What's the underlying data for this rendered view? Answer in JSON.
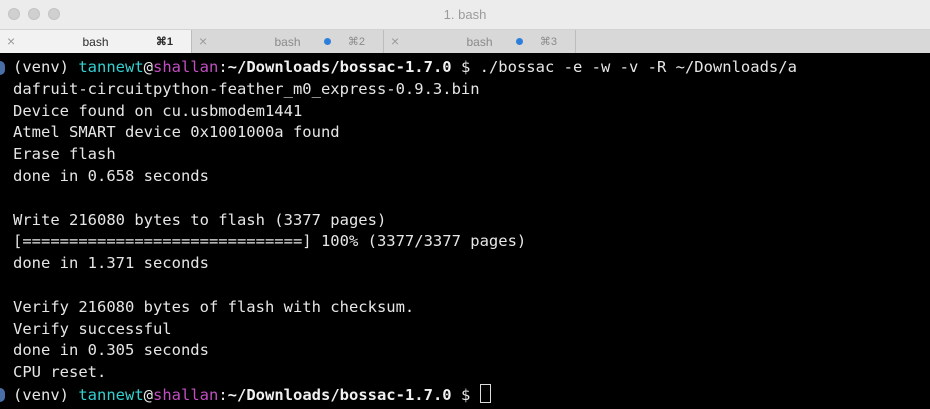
{
  "window": {
    "title": "1. bash"
  },
  "tabs": [
    {
      "close": "×",
      "label": "bash",
      "shortcut": "⌘1",
      "active": true,
      "dot": false
    },
    {
      "close": "×",
      "label": "bash",
      "shortcut": "⌘2",
      "active": false,
      "dot": true
    },
    {
      "close": "×",
      "label": "bash",
      "shortcut": "⌘3",
      "active": false,
      "dot": true
    }
  ],
  "prompt": {
    "prefix": "(venv) ",
    "user": "tannewt",
    "at": "@",
    "host": "shallan",
    "colon": ":",
    "path": "~/Downloads/bossac-1.7.0",
    "symbol": " $ "
  },
  "terminal": {
    "command": "./bossac -e -w -v -R ~/Downloads/a",
    "output": [
      "dafruit-circuitpython-feather_m0_express-0.9.3.bin",
      "Device found on cu.usbmodem1441",
      "Atmel SMART device 0x1001000a found",
      "Erase flash",
      "done in 0.658 seconds",
      "",
      "Write 216080 bytes to flash (3377 pages)",
      "[==============================] 100% (3377/3377 pages)",
      "done in 1.371 seconds",
      "",
      "Verify 216080 bytes of flash with checksum.",
      "Verify successful",
      "done in 0.305 seconds",
      "CPU reset."
    ]
  },
  "colors": {
    "user": "#35cfcf",
    "host": "#c14fc1",
    "path": "#f0f0f0",
    "text": "#e6e6e6",
    "background": "#000000",
    "tab_dot": "#2e7fdc"
  }
}
